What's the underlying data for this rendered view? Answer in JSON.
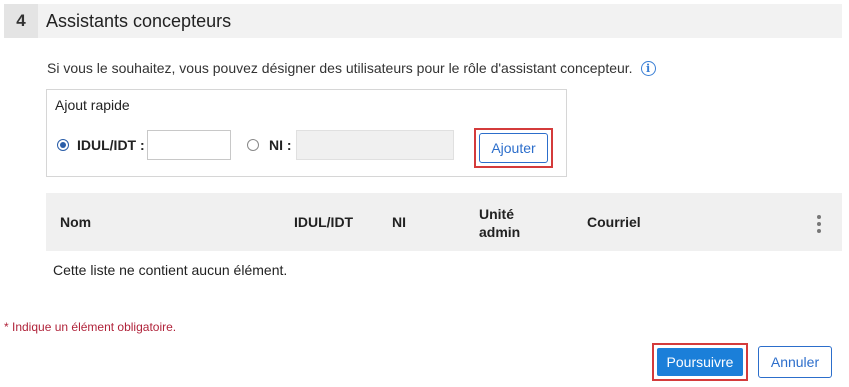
{
  "section": {
    "number": "4",
    "title": "Assistants concepteurs"
  },
  "intro": {
    "text": "Si vous le souhaitez, vous pouvez désigner des utilisateurs pour le rôle d'assistant concepteur.",
    "info_icon": "info-icon"
  },
  "quick_add": {
    "title": "Ajout rapide",
    "idul_label": "IDUL/IDT :",
    "idul_value": "",
    "ni_label": "NI :",
    "ni_value": "",
    "selected": "idul",
    "add_button": "Ajouter"
  },
  "table": {
    "columns": [
      "Nom",
      "IDUL/IDT",
      "NI",
      "Unité",
      "admin",
      "Courriel"
    ],
    "menu_icon": "kebab-menu-icon",
    "empty_message": "Cette liste ne contient aucun élément."
  },
  "required_note": "* Indique un élément obligatoire.",
  "actions": {
    "next": "Poursuivre",
    "cancel": "Annuler"
  },
  "colors": {
    "primary": "#1b7fd9",
    "highlight": "#d43b3b",
    "required": "#b0233a"
  }
}
